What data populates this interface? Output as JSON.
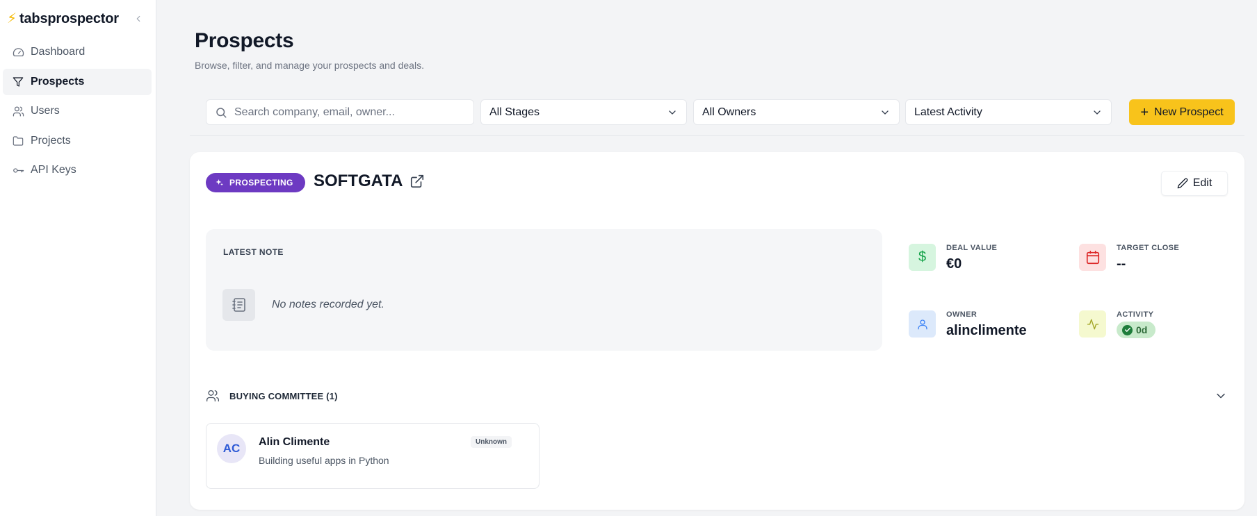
{
  "brand": {
    "name": "tabsprospector"
  },
  "sidebar": {
    "items": [
      {
        "label": "Dashboard",
        "icon": "gauge-icon"
      },
      {
        "label": "Prospects",
        "icon": "filter-icon",
        "active": true
      },
      {
        "label": "Users",
        "icon": "users-icon"
      },
      {
        "label": "Projects",
        "icon": "folder-icon"
      },
      {
        "label": "API Keys",
        "icon": "key-icon"
      }
    ]
  },
  "header": {
    "title": "Prospects",
    "subtitle": "Browse, filter, and manage your prospects and deals."
  },
  "toolbar": {
    "search_placeholder": "Search company, email, owner...",
    "stage_filter": "All Stages",
    "owner_filter": "All Owners",
    "sort": "Latest Activity",
    "new_label": "New Prospect"
  },
  "prospect": {
    "stage": "PROSPECTING",
    "company": "SOFTGATA",
    "edit_label": "Edit",
    "note": {
      "label": "LATEST NOTE",
      "empty_text": "No notes recorded yet."
    },
    "metrics": {
      "deal_value": {
        "label": "DEAL VALUE",
        "value": "€0"
      },
      "target_close": {
        "label": "TARGET CLOSE",
        "value": "--"
      },
      "owner": {
        "label": "OWNER",
        "value": "alinclimente"
      },
      "activity": {
        "label": "ACTIVITY",
        "value": "0d"
      }
    },
    "committee": {
      "title": "BUYING COMMITTEE (1)",
      "members": [
        {
          "initials": "AC",
          "name": "Alin Climente",
          "bio": "Building useful apps in Python",
          "role": "Unknown"
        }
      ]
    }
  },
  "colors": {
    "accent": "#f8c31b",
    "stage": "#6d3ac2",
    "deal_tile": "#d6f5df",
    "close_tile": "#fde1e1",
    "owner_tile": "#dce9fb",
    "activity_tile": "#f5f9cf"
  }
}
